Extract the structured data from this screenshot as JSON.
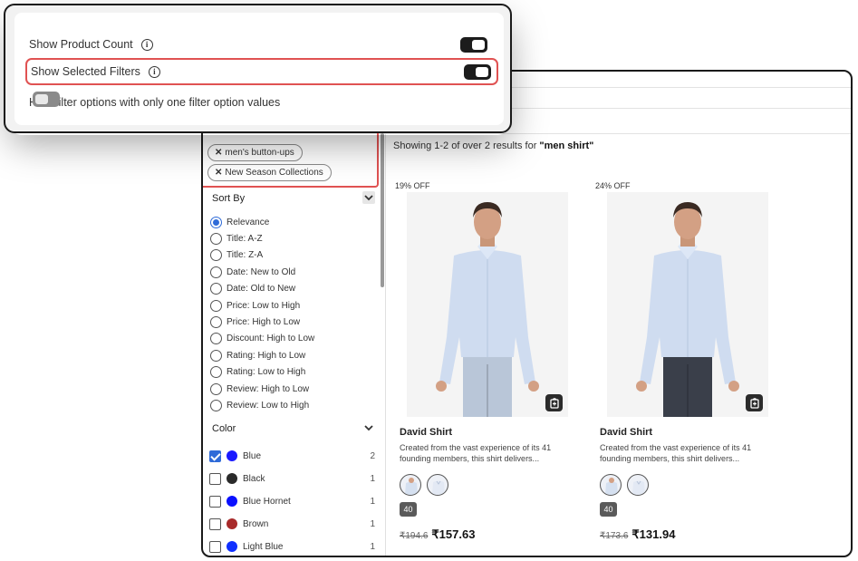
{
  "settings": {
    "rows": [
      {
        "label": "Show Product Count",
        "info": "i",
        "on": true
      },
      {
        "label": "Show Selected Filters",
        "info": "i",
        "on": true
      },
      {
        "label": "Hide filter options with only one filter option values",
        "on": false
      }
    ]
  },
  "filters": {
    "chips": [
      "men's button-ups",
      "New Season Collections"
    ],
    "chip_remove_glyph": "✕"
  },
  "sort": {
    "title": "Sort By",
    "options": [
      "Relevance",
      "Title: A-Z",
      "Title: Z-A",
      "Date: New to Old",
      "Date: Old to New",
      "Price: Low to High",
      "Price: High to Low",
      "Discount: High to Low",
      "Rating: High to Low",
      "Rating: Low to High",
      "Review: High to Low",
      "Review: Low to High"
    ],
    "selected": "Relevance"
  },
  "color": {
    "title": "Color",
    "options": [
      {
        "name": "Blue",
        "count": "2",
        "swatch": "#1a1aff",
        "checked": true
      },
      {
        "name": "Black",
        "count": "1",
        "swatch": "#2a2a2a",
        "checked": false
      },
      {
        "name": "Blue Hornet",
        "count": "1",
        "swatch": "#0a10ff",
        "checked": false
      },
      {
        "name": "Brown",
        "count": "1",
        "swatch": "#a82a2a",
        "checked": false
      },
      {
        "name": "Light Blue",
        "count": "1",
        "swatch": "#1030ff",
        "checked": false
      }
    ]
  },
  "results": {
    "prefix": "Showing 1-2 of over 2 results for ",
    "query": "\"men shirt\""
  },
  "products": [
    {
      "discount": "19% OFF",
      "name": "David Shirt",
      "description": "Created from the vast experience of its 41 founding members, this shirt delivers...",
      "size": "40",
      "old_price": "₹194.6",
      "price": "₹157.63",
      "trouser": "#b9c6d8"
    },
    {
      "discount": "24% OFF",
      "name": "David Shirt",
      "description": "Created from the vast experience of its 41 founding members, this shirt delivers...",
      "size": "40",
      "old_price": "₹173.6",
      "price": "₹131.94",
      "trouser": "#3a3f4a"
    }
  ],
  "colors": {
    "accent": "#2f6bd8",
    "highlight": "#e05252"
  }
}
